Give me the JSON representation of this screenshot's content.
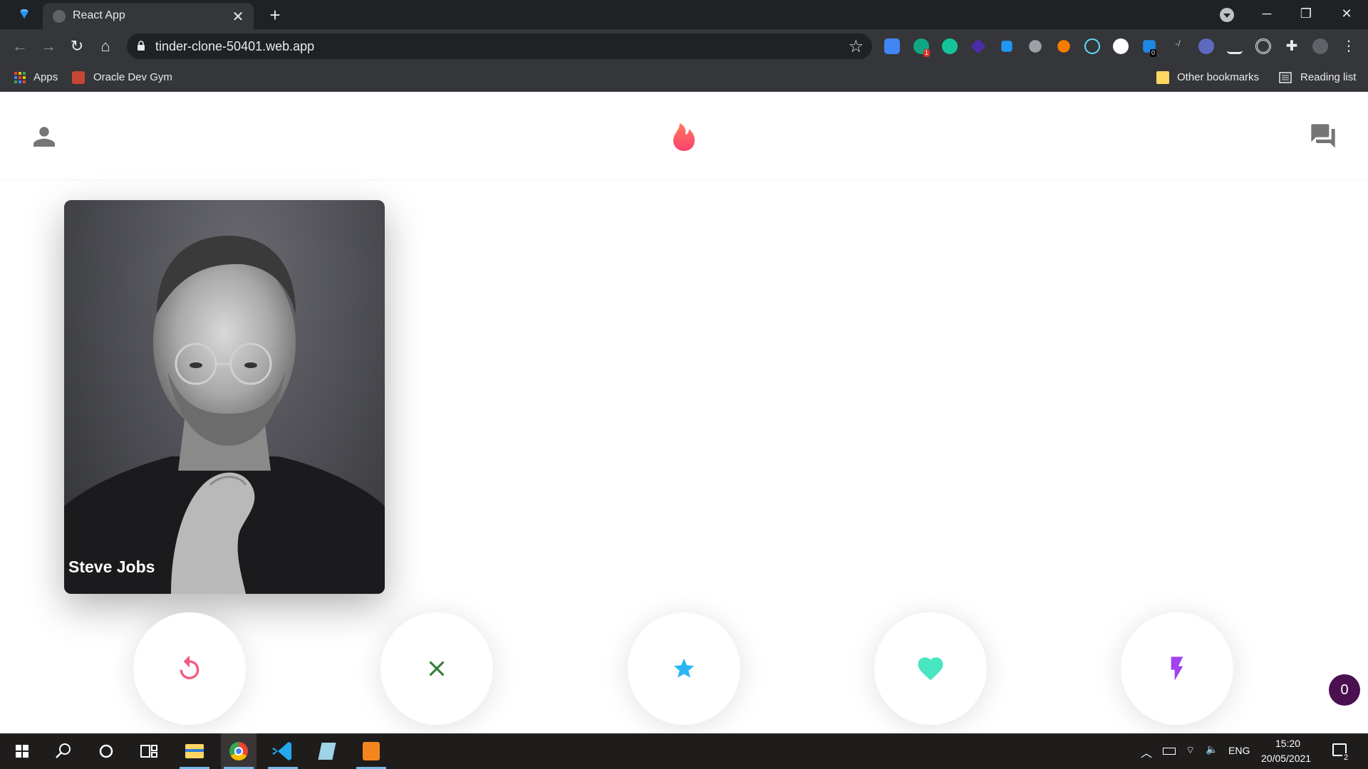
{
  "browser": {
    "tab_title": "React App",
    "new_tab_symbol": "+",
    "url": "tinder-clone-50401.web.app",
    "bookmarks": {
      "apps": "Apps",
      "oracle": "Oracle Dev Gym",
      "other": "Other bookmarks",
      "reading": "Reading list"
    },
    "extension_badges": [
      "1",
      "0"
    ]
  },
  "app": {
    "card": {
      "name": "Steve Jobs"
    },
    "buttons": [
      {
        "name": "replay-button",
        "icon": "replay-icon",
        "color": "#f5597e"
      },
      {
        "name": "nope-button",
        "icon": "close-icon",
        "color": "#2e7d32"
      },
      {
        "name": "super-like-button",
        "icon": "star-icon",
        "color": "#29b6f6"
      },
      {
        "name": "like-button",
        "icon": "heart-icon",
        "color": "#47e6c0"
      },
      {
        "name": "boost-button",
        "icon": "flash-icon",
        "color": "#a342f0"
      }
    ],
    "brand_color": "#fd5068",
    "notification_count": "0"
  },
  "taskbar": {
    "language": "ENG",
    "time": "15:20",
    "date": "20/05/2021",
    "notifications": "2"
  }
}
